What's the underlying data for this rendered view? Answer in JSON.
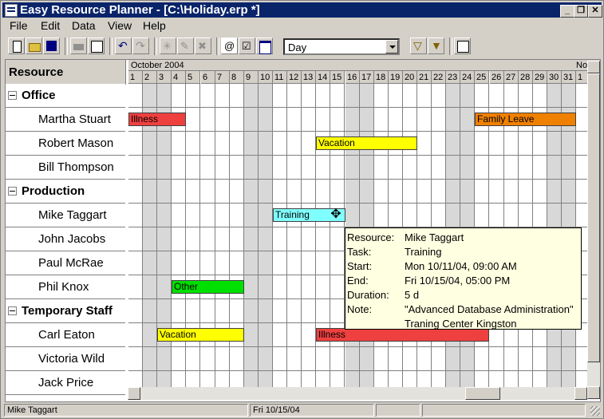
{
  "window": {
    "title": "Easy Resource Planner - [C:\\Holiday.erp *]"
  },
  "menu": [
    "File",
    "Edit",
    "Data",
    "View",
    "Help"
  ],
  "toolbar": {
    "view_mode": "Day"
  },
  "timeline": {
    "month_label": "October 2004",
    "next_month_label": "No",
    "days": [
      "1",
      "2",
      "3",
      "4",
      "5",
      "6",
      "7",
      "8",
      "9",
      "10",
      "11",
      "12",
      "13",
      "14",
      "15",
      "16",
      "17",
      "18",
      "19",
      "20",
      "21",
      "22",
      "23",
      "24",
      "25",
      "26",
      "27",
      "28",
      "29",
      "30",
      "31",
      "1"
    ]
  },
  "resource_header": "Resource",
  "rows": [
    {
      "type": "group",
      "label": "Office"
    },
    {
      "type": "person",
      "label": "Martha Stuart"
    },
    {
      "type": "person",
      "label": "Robert Mason"
    },
    {
      "type": "person",
      "label": "Bill Thompson"
    },
    {
      "type": "group",
      "label": "Production"
    },
    {
      "type": "person",
      "label": "Mike Taggart"
    },
    {
      "type": "person",
      "label": "John Jacobs"
    },
    {
      "type": "person",
      "label": "Paul McRae"
    },
    {
      "type": "person",
      "label": "Phil Knox"
    },
    {
      "type": "group",
      "label": "Temporary Staff"
    },
    {
      "type": "person",
      "label": "Carl Eaton"
    },
    {
      "type": "person",
      "label": "Victoria Wild"
    },
    {
      "type": "person",
      "label": "Jack Price"
    }
  ],
  "tasks": [
    {
      "label": "Illness",
      "color": "#ef4040",
      "row": 1,
      "start": 1,
      "end": 4
    },
    {
      "label": "Family Leave",
      "color": "#f08000",
      "row": 1,
      "start": 25,
      "end": 31
    },
    {
      "label": "Vacation",
      "color": "#ffff00",
      "row": 2,
      "start": 14,
      "end": 20
    },
    {
      "label": "Training",
      "color": "#80ffff",
      "row": 5,
      "start": 11,
      "end": 15
    },
    {
      "label": "Other",
      "color": "#00e000",
      "row": 8,
      "start": 4,
      "end": 8
    },
    {
      "label": "Vacation",
      "color": "#ffff00",
      "row": 10,
      "start": 3,
      "end": 8
    },
    {
      "label": "Illness",
      "color": "#ef4040",
      "row": 10,
      "start": 14,
      "end": 25
    }
  ],
  "tooltip": {
    "resource_label": "Resource:",
    "resource": "Mike Taggart",
    "task_label": "Task:",
    "task": "Training",
    "start_label": "Start:",
    "start": "Mon 10/11/04, 09:00 AM",
    "end_label": "End:",
    "end": "Fri 10/15/04, 05:00 PM",
    "duration_label": "Duration:",
    "duration": "5 d",
    "note_label": "Note:",
    "note_line1": "\"Advanced Database Administration\"",
    "note_line2": "Traning Center Kingston"
  },
  "status": {
    "resource": "Mike Taggart",
    "date": "Fri 10/15/04"
  }
}
